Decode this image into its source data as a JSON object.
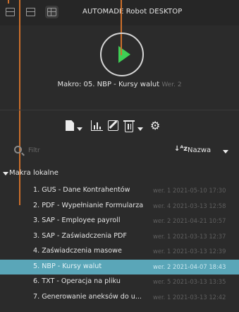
{
  "window": {
    "title": "AUTOMADE Robot DESKTOP"
  },
  "player": {
    "macro_label": "Makro: 05. NBP - Kursy walut",
    "version_label": "Wer. 2"
  },
  "filter": {
    "placeholder": "Filtr",
    "value": ""
  },
  "sort": {
    "icon_text": "↓ᴬz",
    "label": "Nazwa"
  },
  "group": {
    "label": "Makra lokalne"
  },
  "macros": [
    {
      "name": "1. GUS - Dane Kontrahentów",
      "meta": "wer. 1  2021-05-10 17:30",
      "selected": false
    },
    {
      "name": "2. PDF - Wypełnianie Formularza",
      "meta": "wer. 4  2021-03-13 12:58",
      "selected": false
    },
    {
      "name": "3. SAP - Employee payroll",
      "meta": "wer. 2  2021-04-21 10:57",
      "selected": false
    },
    {
      "name": "3. SAP - Zaświadczenia PDF",
      "meta": "wer. 1  2021-03-13 12:37",
      "selected": false
    },
    {
      "name": "4. Zaświadczenia masowe",
      "meta": "wer. 1  2021-03-13 12:39",
      "selected": false
    },
    {
      "name": "5. NBP - Kursy walut",
      "meta": "wer. 2  2021-04-07 18:43",
      "selected": true
    },
    {
      "name": "6. TXT - Operacja na pliku",
      "meta": "wer. 5  2021-03-13 13:35",
      "selected": false
    },
    {
      "name": "7. Generowanie aneksów do u...",
      "meta": "wer. 1  2021-03-13 12:42",
      "selected": false
    }
  ],
  "colors": {
    "accent_play": "#3fcf55",
    "selection": "#5aa6b8",
    "guide": "#cc6f2b"
  }
}
